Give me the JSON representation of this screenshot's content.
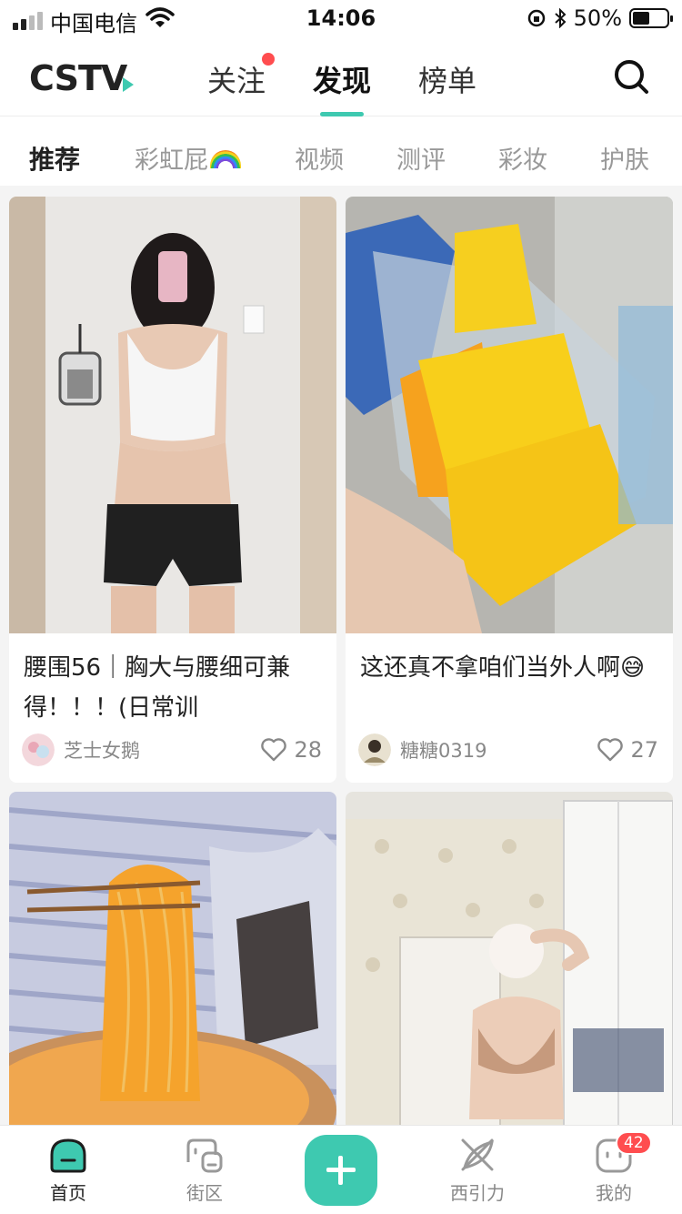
{
  "status_bar": {
    "carrier": "中国电信",
    "time": "14:06",
    "battery": "50%",
    "battery_level": 0.5
  },
  "header": {
    "logo": "CSTV",
    "tabs": [
      {
        "label": "关注",
        "has_dot": true
      },
      {
        "label": "发现",
        "active": true
      },
      {
        "label": "榜单"
      }
    ],
    "search_icon": "search-icon"
  },
  "sub_tabs": [
    "推荐",
    "彩虹屁",
    "视频",
    "测评",
    "彩妆",
    "护肤"
  ],
  "cards": [
    {
      "title": "腰围56｜胸大与腰细可兼得！！！(日常训",
      "author": "芝士女鹅",
      "likes": "28"
    },
    {
      "title": "这还真不拿咱们当外人啊😅",
      "author": "糖糖0319",
      "likes": "27"
    },
    {
      "title": "",
      "author": "",
      "likes": ""
    },
    {
      "title": "",
      "author": "",
      "likes": ""
    }
  ],
  "bottom_nav": {
    "items": [
      {
        "label": "首页",
        "icon": "home-icon"
      },
      {
        "label": "街区",
        "icon": "street-icon"
      },
      {
        "label": "",
        "icon": "plus-icon"
      },
      {
        "label": "西引力",
        "icon": "xiyinli-icon"
      },
      {
        "label": "我的",
        "icon": "profile-icon",
        "badge": "42"
      }
    ]
  },
  "colors": {
    "accent": "#3ec9b0",
    "badge": "#ff4d4f"
  }
}
